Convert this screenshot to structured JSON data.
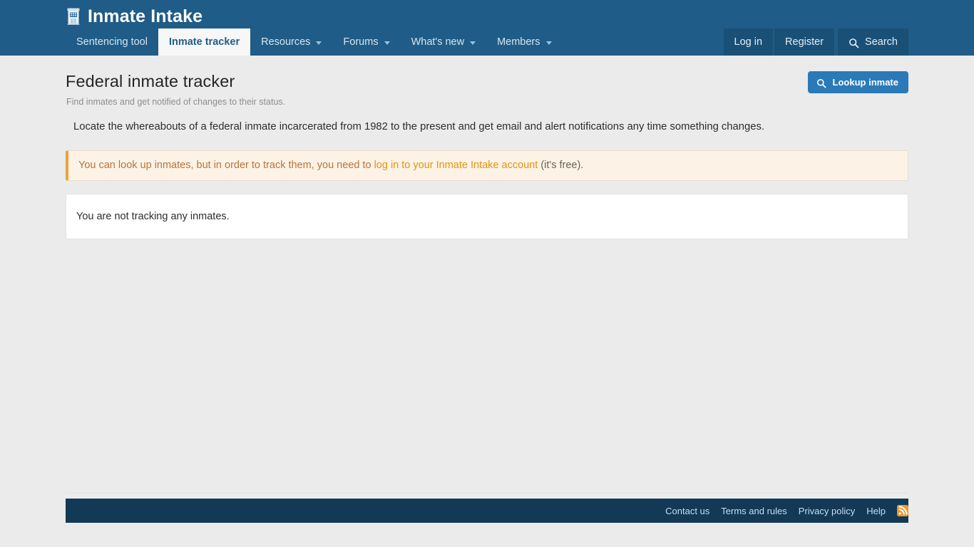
{
  "header": {
    "brand_title": "Inmate Intake",
    "brand_icon": "prison-building-icon",
    "nav_left": [
      {
        "label": "Sentencing tool",
        "has_caret": false,
        "active": false
      },
      {
        "label": "Inmate tracker",
        "has_caret": false,
        "active": true
      },
      {
        "label": "Resources",
        "has_caret": true,
        "active": false
      },
      {
        "label": "Forums",
        "has_caret": true,
        "active": false
      },
      {
        "label": "What's new",
        "has_caret": true,
        "active": false
      },
      {
        "label": "Members",
        "has_caret": true,
        "active": false
      }
    ],
    "nav_right": [
      {
        "label": "Log in"
      },
      {
        "label": "Register"
      },
      {
        "label": "Search",
        "icon": "search-icon"
      }
    ]
  },
  "main": {
    "title": "Federal inmate tracker",
    "subtitle": "Find inmates and get notified of changes to their status.",
    "lookup_button": {
      "label": "Lookup inmate",
      "icon": "search-icon"
    },
    "intro": "Locate the whereabouts of a federal inmate incarcerated from 1982 to the present and get email and alert notifications any time something changes.",
    "alert": {
      "prefix": "You can look up inmates, but in order to track them, you need to ",
      "link": "log in to your Inmate Intake account",
      "suffix": " (it's free)."
    },
    "tracking_block": {
      "message": "You are not tracking any inmates."
    }
  },
  "footer": {
    "links": [
      {
        "label": "Contact us"
      },
      {
        "label": "Terms and rules"
      },
      {
        "label": "Privacy policy"
      },
      {
        "label": "Help"
      }
    ],
    "rss_icon": "rss-icon"
  },
  "colors": {
    "header_blue": "#1f5c87",
    "footer_navy": "#123a57",
    "accent_button": "#2a7ab9",
    "alert_border": "#e8a33d",
    "alert_link": "#e8920e",
    "rss_orange": "#f0962e",
    "page_bg": "#ebebeb"
  }
}
